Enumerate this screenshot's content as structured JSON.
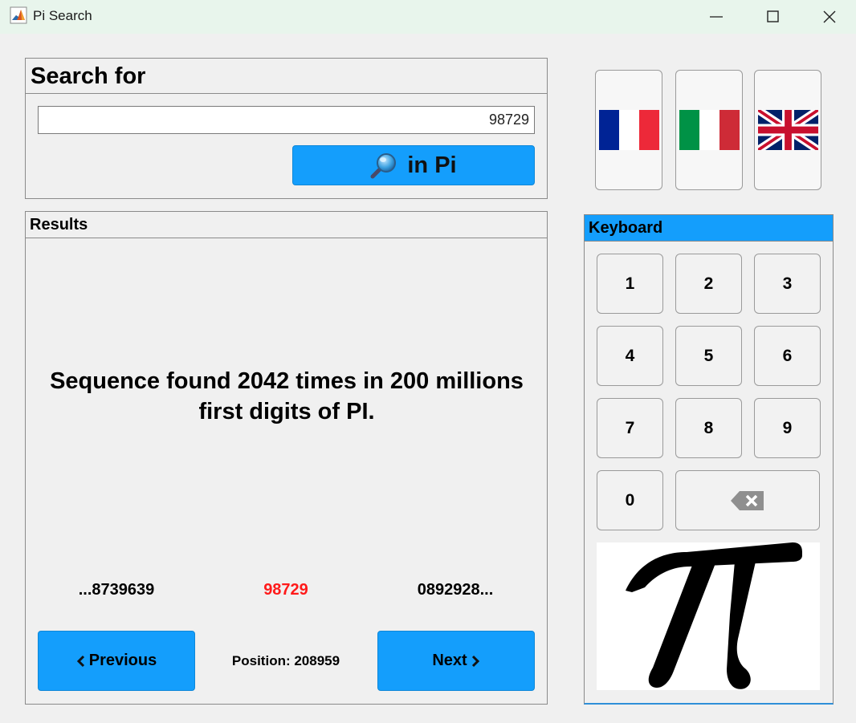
{
  "window": {
    "title": "Pi Search",
    "icon": "matlab-icon",
    "controls": [
      "minimize-icon",
      "maximize-icon",
      "close-icon"
    ]
  },
  "search": {
    "title": "Search for",
    "value": "98729",
    "button_label": "in Pi",
    "button_icon": "magnifier-icon",
    "accent": "#149efc"
  },
  "languages": [
    {
      "name": "french-flag-icon",
      "colors": [
        "#002395",
        "#ffffff",
        "#ed2939"
      ]
    },
    {
      "name": "italian-flag-icon",
      "colors": [
        "#009246",
        "#ffffff",
        "#ce2b37"
      ]
    },
    {
      "name": "uk-flag-icon",
      "colors": [
        "#012169",
        "#ffffff",
        "#c8102e"
      ]
    }
  ],
  "results": {
    "title": "Results",
    "message": "Sequence found 2042 times in 200 millions first digits of PI.",
    "before": "...8739639",
    "match": "98729",
    "after": "0892928...",
    "match_color": "#ff1a1a",
    "position": "Position: 208959",
    "previous_label": "Previous",
    "next_label": "Next"
  },
  "keyboard": {
    "title": "Keyboard",
    "keys": [
      "1",
      "2",
      "3",
      "4",
      "5",
      "6",
      "7",
      "8",
      "9",
      "0"
    ],
    "backspace_icon": "backspace-icon",
    "image": "pi-symbol-icon"
  }
}
